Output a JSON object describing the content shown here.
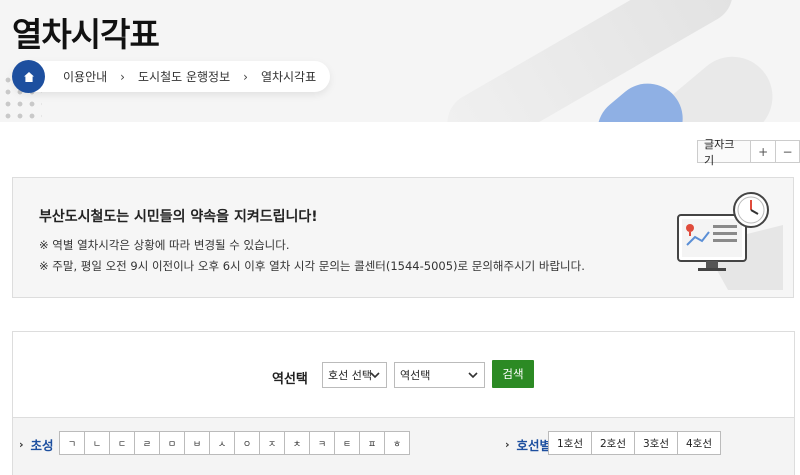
{
  "header": {
    "title": "열차시각표",
    "breadcrumb": [
      "이용안내",
      "도시철도 운행정보",
      "열차시각표"
    ]
  },
  "fontsize": {
    "label": "글자크기",
    "plus": "+",
    "minus": "−"
  },
  "notice": {
    "title": "부산도시철도는 시민들의 약속을 지켜드립니다!",
    "line1": "※ 역별 열차시각은 상황에 따라 변경될 수 있습니다.",
    "line2": "※ 주말, 평일 오전 9시 이전이나 오후 6시 이후 열차 시각 문의는 콜센터(1544-5005)로 문의해주시기 바랍니다."
  },
  "search": {
    "label": "역선택",
    "line_select": "호선 선택",
    "station_select": "역선택",
    "button": "검색"
  },
  "filters": {
    "initials_label": "초성",
    "initials": [
      "ㄱ",
      "ㄴ",
      "ㄷ",
      "ㄹ",
      "ㅁ",
      "ㅂ",
      "ㅅ",
      "ㅇ",
      "ㅈ",
      "ㅊ",
      "ㅋ",
      "ㅌ",
      "ㅍ",
      "ㅎ"
    ],
    "lines_label": "호선별",
    "lines": [
      "1호선",
      "2호선",
      "3호선",
      "4호선"
    ]
  },
  "colors": {
    "brand_blue": "#1d4f9f",
    "search_green": "#2c8a24"
  }
}
